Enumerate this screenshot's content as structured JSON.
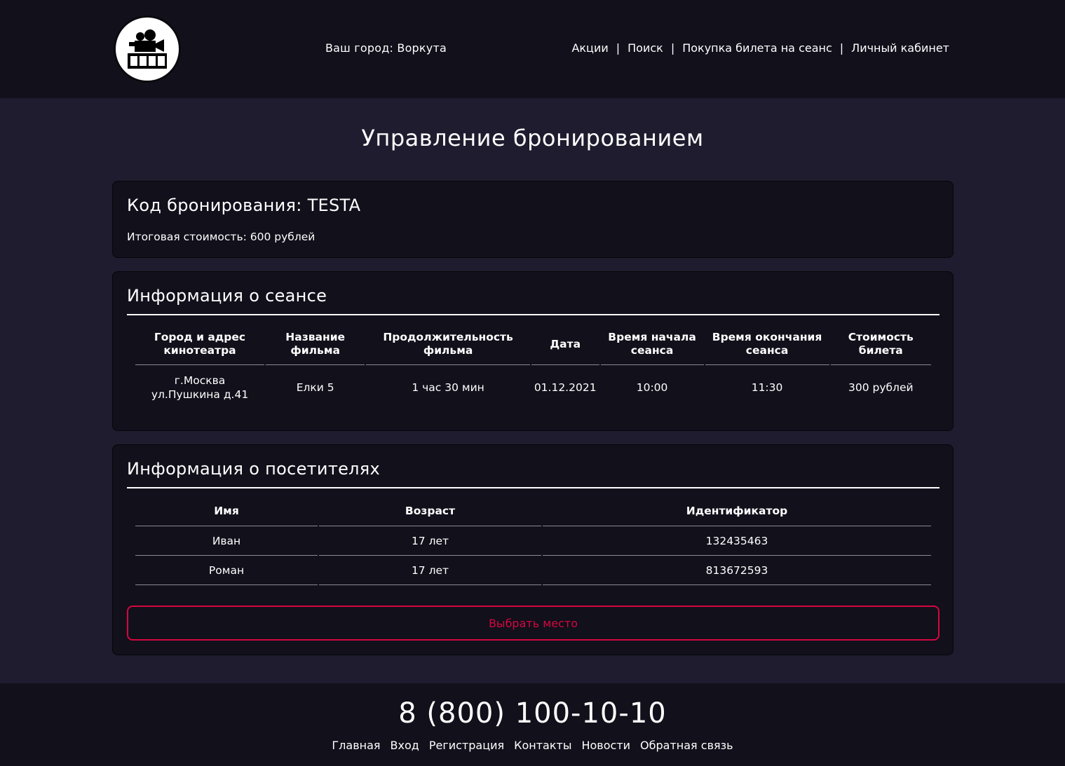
{
  "header": {
    "logo_icon": "film-camera-icon",
    "city_label": "Ваш город: Воркута",
    "nav": [
      {
        "label": "Акции"
      },
      {
        "label": "Поиск"
      },
      {
        "label": "Покупка билета на сеанс"
      },
      {
        "label": "Личный кабинет"
      }
    ],
    "separator": "|"
  },
  "page_title": "Управление бронированием",
  "booking": {
    "code_label": "Код бронирования: TESTA",
    "total_label": "Итоговая стоимость: 600 рублей"
  },
  "session": {
    "title": "Информация о сеансе",
    "columns": [
      "Город и адрес кинотеатра",
      "Название фильма",
      "Продолжительность фильма",
      "Дата",
      "Время начала сеанса",
      "Время окончания сеанса",
      "Стоимость билета"
    ],
    "row": {
      "address_line1": "г.Москва",
      "address_line2": "ул.Пушкина д.41",
      "film": "Елки 5",
      "duration": "1 час 30 мин",
      "date": "01.12.2021",
      "start": "10:00",
      "end": "11:30",
      "price": "300 рублей"
    }
  },
  "visitors": {
    "title": "Информация о посетителях",
    "columns": [
      "Имя",
      "Возраст",
      "Идентификатор"
    ],
    "rows": [
      {
        "name": "Иван",
        "age": "17 лет",
        "id": "132435463"
      },
      {
        "name": "Роман",
        "age": "17 лет",
        "id": "813672593"
      }
    ],
    "button_label": "Выбрать место"
  },
  "footer": {
    "phone": "8 (800) 100-10-10",
    "links": [
      "Главная",
      "Вход",
      "Регистрация",
      "Контакты",
      "Новости",
      "Обратная связь"
    ]
  },
  "colors": {
    "header_bg": "#11101b",
    "page_bg": "#1e1c2e",
    "accent": "#d4073f"
  }
}
